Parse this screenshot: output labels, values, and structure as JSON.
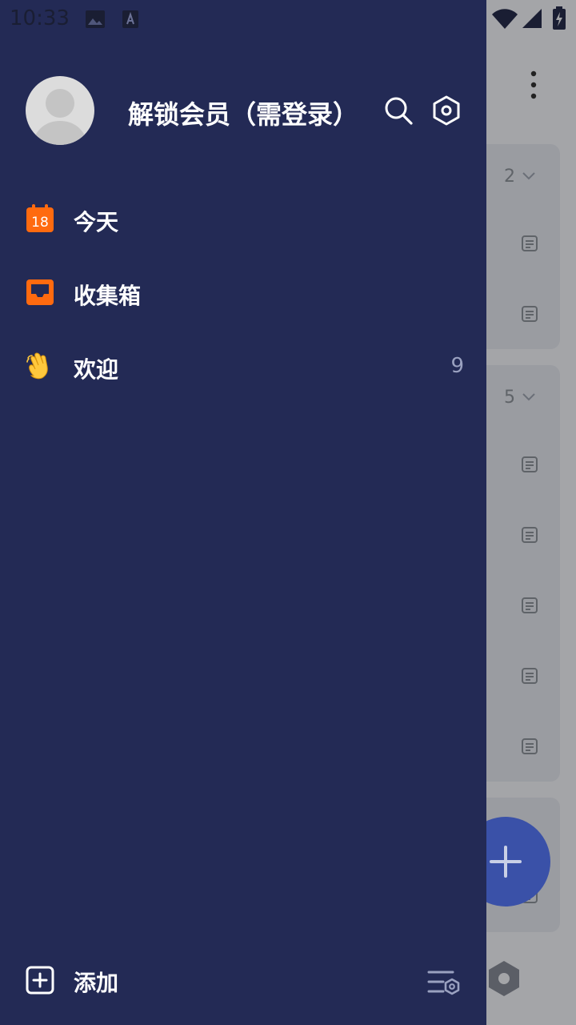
{
  "status_bar": {
    "time": "10:33"
  },
  "drawer": {
    "title": "解锁会员（需登录）",
    "nav": [
      {
        "label": "今天",
        "icon": "calendar-icon",
        "badge": "18",
        "count": ""
      },
      {
        "label": "收集箱",
        "icon": "inbox-icon",
        "count": ""
      },
      {
        "label": "欢迎",
        "icon": "waving-hand-icon",
        "count": "9"
      }
    ],
    "add_label": "添加"
  },
  "background": {
    "group_counts": [
      "2",
      "5"
    ]
  },
  "colors": {
    "drawer_bg": "#232a55",
    "accent_orange": "#ff6a0f",
    "fab_blue": "#3a51a8"
  }
}
